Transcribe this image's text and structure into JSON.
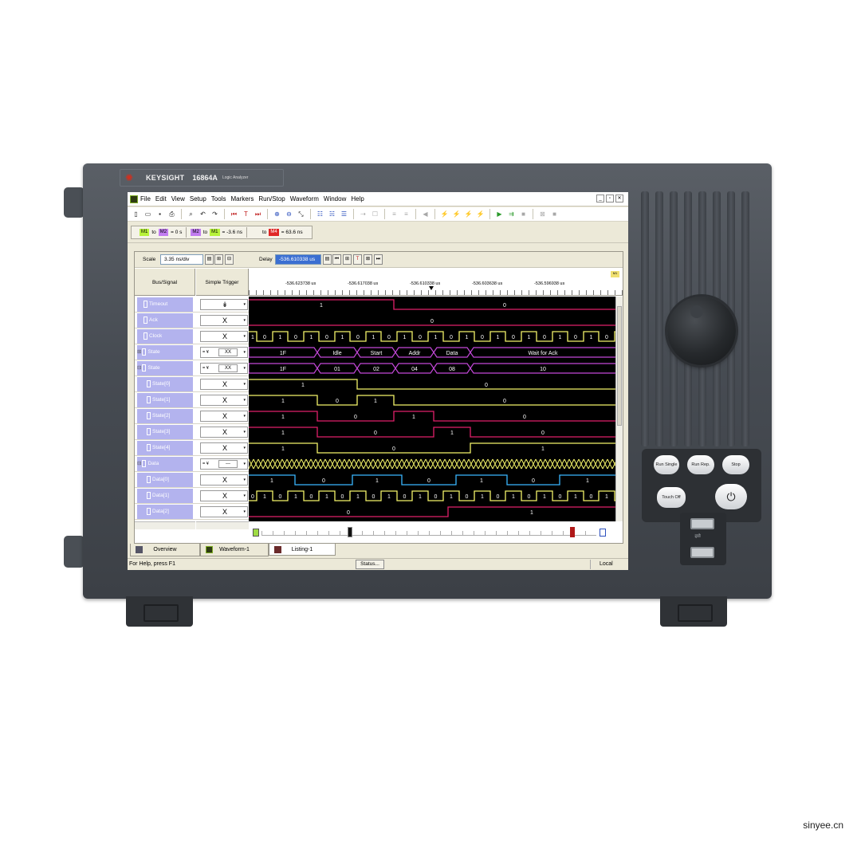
{
  "device": {
    "brand": "KEYSIGHT",
    "model": "16864A",
    "description": "Logic Analyzer",
    "buttons": {
      "run_single": "Run Single",
      "run_rep": "Run Rep.",
      "stop": "Stop",
      "touch_off": "Touch Off",
      "power_icon": "power-icon"
    }
  },
  "menu": [
    "File",
    "Edit",
    "View",
    "Setup",
    "Tools",
    "Markers",
    "Run/Stop",
    "Waveform",
    "Window",
    "Help"
  ],
  "markers": {
    "m1_label": "M1",
    "to1": "to",
    "m2_label": "M2",
    "eq1": "= 0 s",
    "m2b_label": "M2",
    "to2": "to",
    "m1b_label": "M1",
    "eq2": "= -3.6 ns",
    "to3": "to",
    "m4_label": "M4",
    "eq3": "= 63.6 ns"
  },
  "scale": {
    "label": "Scale",
    "value": "3.35 ns/div"
  },
  "delay": {
    "label": "Delay",
    "value": "-536.610338 us"
  },
  "columns": {
    "bus": "Bus/Signal",
    "trigger": "Simple Trigger"
  },
  "ruler": {
    "labels": [
      "-536.623738 us",
      "-536.617038 us",
      "-536.610338 us",
      "-536.603638 us",
      "-536.596938 us"
    ],
    "flag": "M1"
  },
  "rows": [
    {
      "name": "Timeout",
      "tree": "",
      "trigger": "↡",
      "bus": false
    },
    {
      "name": "Ack",
      "tree": "",
      "trigger": "X",
      "bus": false
    },
    {
      "name": "Clock",
      "tree": "",
      "trigger": "X",
      "bus": false
    },
    {
      "name": "State",
      "tree": "⊞",
      "trigger": "XX",
      "op": "= ¥",
      "bus": true
    },
    {
      "name": "State",
      "tree": "⊟",
      "trigger": "XX",
      "op": "= ¥",
      "bus": true
    },
    {
      "name": "State[0]",
      "tree": "",
      "trigger": "X",
      "bus": false
    },
    {
      "name": "State[1]",
      "tree": "",
      "trigger": "X",
      "bus": false
    },
    {
      "name": "State[2]",
      "tree": "",
      "trigger": "X",
      "bus": false
    },
    {
      "name": "State[3]",
      "tree": "",
      "trigger": "X",
      "bus": false
    },
    {
      "name": "State[4]",
      "tree": "",
      "trigger": "X",
      "bus": false
    },
    {
      "name": "Data",
      "tree": "⊟",
      "trigger": "---",
      "op": "= ¥",
      "bus": true
    },
    {
      "name": "Data[0]",
      "tree": "",
      "trigger": "X",
      "bus": false
    },
    {
      "name": "Data[1]",
      "tree": "",
      "trigger": "X",
      "bus": false
    },
    {
      "name": "Data[2]",
      "tree": "",
      "trigger": "X",
      "bus": false
    }
  ],
  "waveform": {
    "timeout": {
      "before": "1",
      "after": "0"
    },
    "ack": "0",
    "clock_values": [
      "1",
      "0",
      "1",
      "0",
      "1",
      "0",
      "1",
      "0",
      "1",
      "0",
      "1",
      "0",
      "1",
      "0",
      "1",
      "0",
      "1",
      "0",
      "1",
      "0",
      "1",
      "0",
      "1",
      "0"
    ],
    "state_symbols": [
      "1F",
      "Idle",
      "Start",
      "Addr",
      "Data",
      "Wait for Ack"
    ],
    "state_hex": [
      "1F",
      "01",
      "02",
      "04",
      "08",
      "10"
    ],
    "state0": [
      "1",
      "0"
    ],
    "state1": [
      "1",
      "0",
      "1",
      "0"
    ],
    "state2": [
      "1",
      "0",
      "1",
      "0"
    ],
    "state3": [
      "1",
      "0",
      "1",
      "0"
    ],
    "state4": [
      "1",
      "0",
      "1"
    ],
    "data0": [
      "1",
      "0",
      "1",
      "0",
      "1",
      "0",
      "1"
    ],
    "data1": [
      "0",
      "1",
      "0",
      "1",
      "0",
      "1",
      "0",
      "1",
      "0",
      "1",
      "0",
      "1",
      "0",
      "1",
      "0",
      "1",
      "0",
      "1",
      "0",
      "1",
      "0",
      "1",
      "0",
      "1"
    ],
    "data2": [
      "0",
      "1"
    ]
  },
  "tabs": [
    "Overview",
    "Waveform-1",
    "Listing-1"
  ],
  "status": {
    "help": "For Help, press F1",
    "button": "Status...",
    "mode": "Local"
  },
  "watermark": "sinyee.cn",
  "colors": {
    "timeout": "#e0206a",
    "ack": "#e0206a",
    "clock": "#f3f36a",
    "state": "#c348d8",
    "state0": "#f3f36a",
    "state1": "#f3f36a",
    "state2": "#e0206a",
    "state3": "#e0206a",
    "state4": "#f3f36a",
    "data": "#f3f36a",
    "data0": "#39b7ff",
    "data1": "#f3f36a",
    "data2": "#e0206a"
  }
}
